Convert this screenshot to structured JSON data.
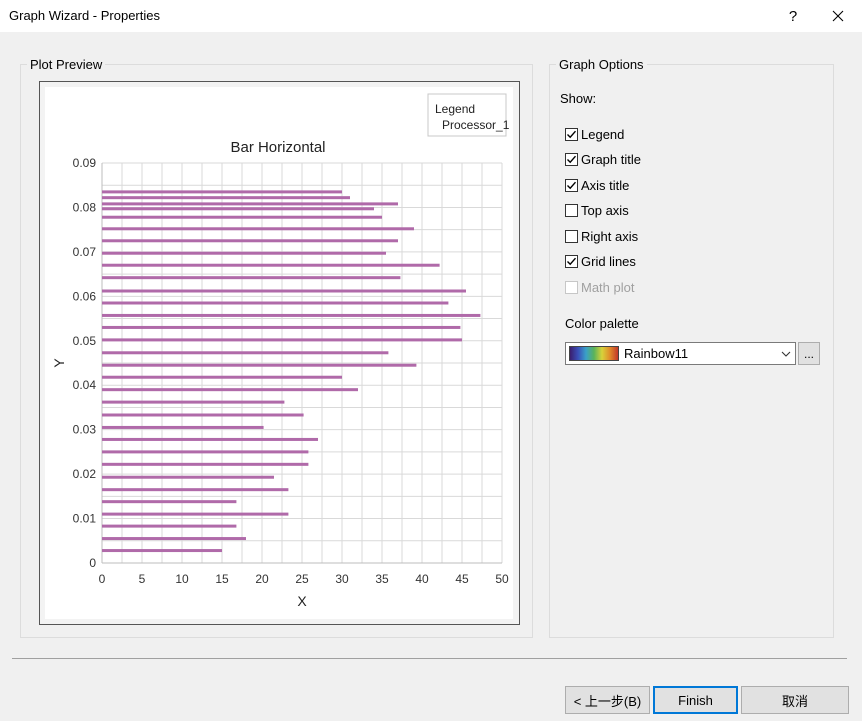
{
  "window": {
    "title": "Graph Wizard - Properties",
    "help": "?"
  },
  "plot_group": {
    "title": "Plot Preview"
  },
  "options_group": {
    "title": "Graph Options"
  },
  "show_label": "Show:",
  "options": [
    {
      "label": "Legend",
      "checked": true,
      "enabled": true
    },
    {
      "label": "Graph title",
      "checked": true,
      "enabled": true
    },
    {
      "label": "Axis title",
      "checked": true,
      "enabled": true
    },
    {
      "label": "Top axis",
      "checked": false,
      "enabled": true
    },
    {
      "label": "Right axis",
      "checked": false,
      "enabled": true
    },
    {
      "label": "Grid lines",
      "checked": true,
      "enabled": true
    },
    {
      "label": "Math plot",
      "checked": false,
      "enabled": false
    }
  ],
  "palette": {
    "label": "Color palette",
    "value": "Rainbow11",
    "more": "..."
  },
  "buttons": {
    "back": "< 上一步(B)",
    "finish": "Finish",
    "cancel": "取消"
  },
  "colors": {
    "bar": "#b06aa9",
    "grid": "#d9d9d9",
    "accent": "#0078d7"
  },
  "chart_data": {
    "type": "bar",
    "orientation": "horizontal",
    "title": "Bar Horizontal",
    "xlabel": "X",
    "ylabel": "Y",
    "legend": {
      "title": "Legend",
      "entries": [
        "Processor_1"
      ],
      "position": "top-right"
    },
    "grid": true,
    "xlim": [
      0,
      50
    ],
    "ylim": [
      0,
      0.09
    ],
    "x_ticks": [
      "0",
      "5",
      "10",
      "15",
      "20",
      "25",
      "30",
      "35",
      "40",
      "45",
      "50"
    ],
    "y_ticks": [
      "0",
      "0.01",
      "0.02",
      "0.03",
      "0.04",
      "0.05",
      "0.06",
      "0.07",
      "0.08",
      "0.09"
    ],
    "series": [
      {
        "name": "Processor_1",
        "points": [
          {
            "y": 0.0028,
            "x": 15.0
          },
          {
            "y": 0.0055,
            "x": 18.0
          },
          {
            "y": 0.0083,
            "x": 16.8
          },
          {
            "y": 0.011,
            "x": 23.3
          },
          {
            "y": 0.0138,
            "x": 16.8
          },
          {
            "y": 0.0165,
            "x": 23.3
          },
          {
            "y": 0.0193,
            "x": 21.5
          },
          {
            "y": 0.0222,
            "x": 25.8
          },
          {
            "y": 0.025,
            "x": 25.8
          },
          {
            "y": 0.0278,
            "x": 27.0
          },
          {
            "y": 0.0305,
            "x": 20.2
          },
          {
            "y": 0.0333,
            "x": 25.2
          },
          {
            "y": 0.0362,
            "x": 22.8
          },
          {
            "y": 0.039,
            "x": 32.0
          },
          {
            "y": 0.0418,
            "x": 30.0
          },
          {
            "y": 0.0445,
            "x": 39.3
          },
          {
            "y": 0.0473,
            "x": 35.8
          },
          {
            "y": 0.0502,
            "x": 45.0
          },
          {
            "y": 0.053,
            "x": 44.8
          },
          {
            "y": 0.0557,
            "x": 47.3
          },
          {
            "y": 0.0585,
            "x": 43.3
          },
          {
            "y": 0.0612,
            "x": 45.5
          },
          {
            "y": 0.0642,
            "x": 37.3
          },
          {
            "y": 0.067,
            "x": 42.2
          },
          {
            "y": 0.0697,
            "x": 35.5
          },
          {
            "y": 0.0725,
            "x": 37.0
          },
          {
            "y": 0.0752,
            "x": 39.0
          },
          {
            "y": 0.0778,
            "x": 35.0
          },
          {
            "y": 0.0797,
            "x": 34.0
          },
          {
            "y": 0.0808,
            "x": 37.0
          },
          {
            "y": 0.0822,
            "x": 31.0
          },
          {
            "y": 0.0835,
            "x": 30.0
          }
        ]
      }
    ]
  }
}
